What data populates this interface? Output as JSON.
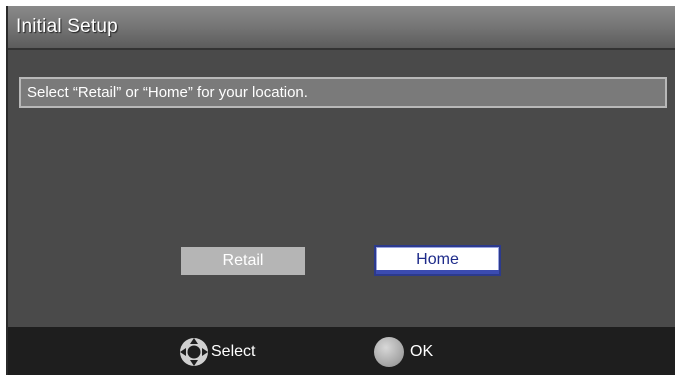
{
  "title_bar": {
    "title": "Initial Setup"
  },
  "message": {
    "text": "Select “Retail” or “Home” for your location."
  },
  "options": {
    "retail_label": "Retail",
    "home_label": "Home",
    "selected": "Home"
  },
  "footer": {
    "select_label": "Select",
    "ok_label": "OK",
    "select_icon": "dpad-icon",
    "ok_icon": "ok-button-icon"
  },
  "colors": {
    "panel_bg": "#4a4a4a",
    "title_bg": "#777777",
    "footer_bg": "#1e1e1e",
    "selected_border": "#2c3a8c",
    "selected_text": "#1e2b8a",
    "unselected_bg": "#b5b5b5"
  }
}
